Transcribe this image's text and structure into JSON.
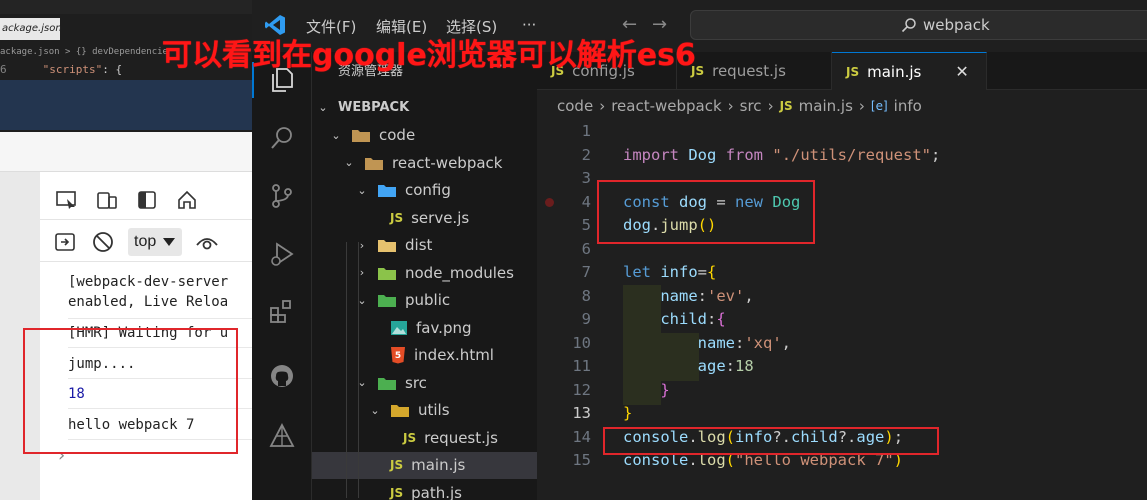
{
  "bg_editor": {
    "tab_label": "ackage.json",
    "breadcrumb": "ackage.json > {} devDependencie",
    "line_number": "6",
    "line_key": "\"scripts\"",
    "line_rest": ": {"
  },
  "devtools": {
    "context": "top",
    "console": [
      "[webpack-dev-server",
      "enabled, Live Reloa",
      "[HMR] Waiting for u",
      "jump....",
      "18",
      "hello webpack 7"
    ],
    "expand_caret": "›"
  },
  "vscode": {
    "menus": [
      "文件(F)",
      "编辑(E)",
      "选择(S)",
      "···"
    ],
    "search": "webpack",
    "sidebar_title": "资源管理器",
    "sidebar_more": "···",
    "tree": [
      {
        "label": "WEBPACK",
        "depth": 0,
        "kind": "root",
        "chevron": "v"
      },
      {
        "label": "code",
        "depth": 1,
        "kind": "folder",
        "chevron": "v"
      },
      {
        "label": "react-webpack",
        "depth": 2,
        "kind": "folder",
        "chevron": "v"
      },
      {
        "label": "config",
        "depth": 3,
        "kind": "folder-config",
        "chevron": "v"
      },
      {
        "label": "serve.js",
        "depth": 4,
        "kind": "js",
        "chevron": ""
      },
      {
        "label": "dist",
        "depth": 3,
        "kind": "folder-dist",
        "chevron": ">"
      },
      {
        "label": "node_modules",
        "depth": 3,
        "kind": "folder-node",
        "chevron": ">"
      },
      {
        "label": "public",
        "depth": 3,
        "kind": "folder-public",
        "chevron": "v"
      },
      {
        "label": "fav.png",
        "depth": 4,
        "kind": "image",
        "chevron": ""
      },
      {
        "label": "index.html",
        "depth": 4,
        "kind": "html",
        "chevron": ""
      },
      {
        "label": "src",
        "depth": 3,
        "kind": "folder-src",
        "chevron": "v"
      },
      {
        "label": "utils",
        "depth": 4,
        "kind": "folder-utils",
        "chevron": "v"
      },
      {
        "label": "request.js",
        "depth": 5,
        "kind": "js",
        "chevron": ""
      },
      {
        "label": "main.js",
        "depth": 4,
        "kind": "js",
        "chevron": "",
        "active": true
      },
      {
        "label": "path.js",
        "depth": 4,
        "kind": "js",
        "chevron": ""
      }
    ],
    "tabs": [
      {
        "label": "config.js",
        "active": false
      },
      {
        "label": "request.js",
        "active": false
      },
      {
        "label": "main.js",
        "active": true
      }
    ],
    "breadcrumb": [
      "code",
      "react-webpack",
      "src",
      "main.js",
      "info"
    ],
    "line_numbers": [
      "1",
      "2",
      "3",
      "4",
      "5",
      "6",
      "7",
      "8",
      "9",
      "10",
      "11",
      "12",
      "13",
      "14",
      "15"
    ],
    "current_line": "13"
  },
  "annotation": "可以看到在google浏览器可以解析es6",
  "colors": {
    "accent_red": "#e0262b",
    "js_yellow": "#cbcb41",
    "vscode_blue": "#0078d4"
  }
}
